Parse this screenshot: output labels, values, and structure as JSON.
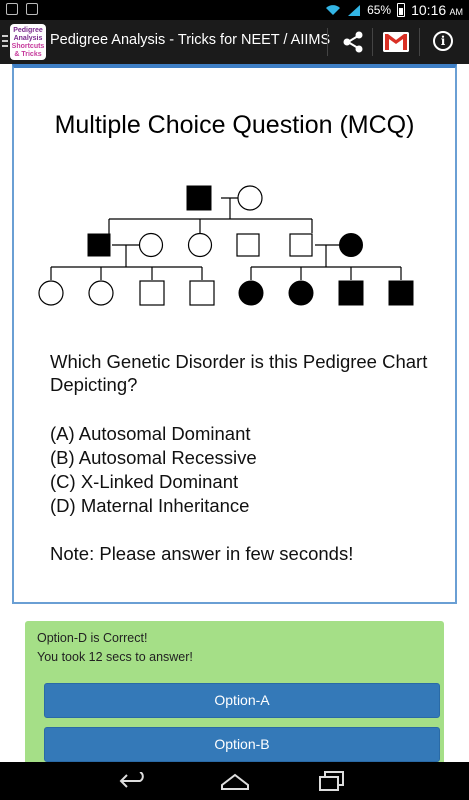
{
  "status_bar": {
    "battery": "65%",
    "time": "10:16",
    "ampm": "AM",
    "icons": [
      "notification-icon",
      "screenshot-icon",
      "wifi-icon",
      "signal-icon",
      "battery-icon"
    ]
  },
  "action_bar": {
    "app_logo_lines": [
      "Pedigree",
      "Analysis",
      "Shortcuts",
      "& Tricks"
    ],
    "title": "Pedigree Analysis - Tricks for NEET / AIIMS",
    "icons": [
      "share-icon",
      "gmail-icon",
      "info-icon"
    ]
  },
  "card": {
    "heading": "Multiple Choice Question (MCQ)",
    "pedigree": {
      "generation1": [
        "male-affected",
        "female-unaffected"
      ],
      "generation2": [
        "male-affected",
        "female-unaffected",
        "female-unaffected",
        "male-unaffected",
        "male-unaffected",
        "female-affected"
      ],
      "generation3": [
        "female-unaffected",
        "female-unaffected",
        "male-unaffected",
        "male-unaffected",
        "female-affected",
        "female-affected",
        "male-affected",
        "male-affected"
      ]
    },
    "question": "Which Genetic Disorder is this Pedigree Chart Depicting?",
    "options": [
      "(A) Autosomal Dominant",
      "(B) Autosomal Recessive",
      "(C) X-Linked Dominant",
      "(D) Maternal Inheritance"
    ],
    "note": "Note: Please answer in few seconds!"
  },
  "answer_panel": {
    "result": "Option-D is Correct!",
    "time_taken": "You took 12 secs to answer!",
    "buttons": [
      "Option-A",
      "Option-B"
    ],
    "background": "#a5df87",
    "button_color": "#3479b8"
  },
  "nav_bar": {
    "icons": [
      "back-icon",
      "home-icon",
      "recent-apps-icon"
    ]
  }
}
